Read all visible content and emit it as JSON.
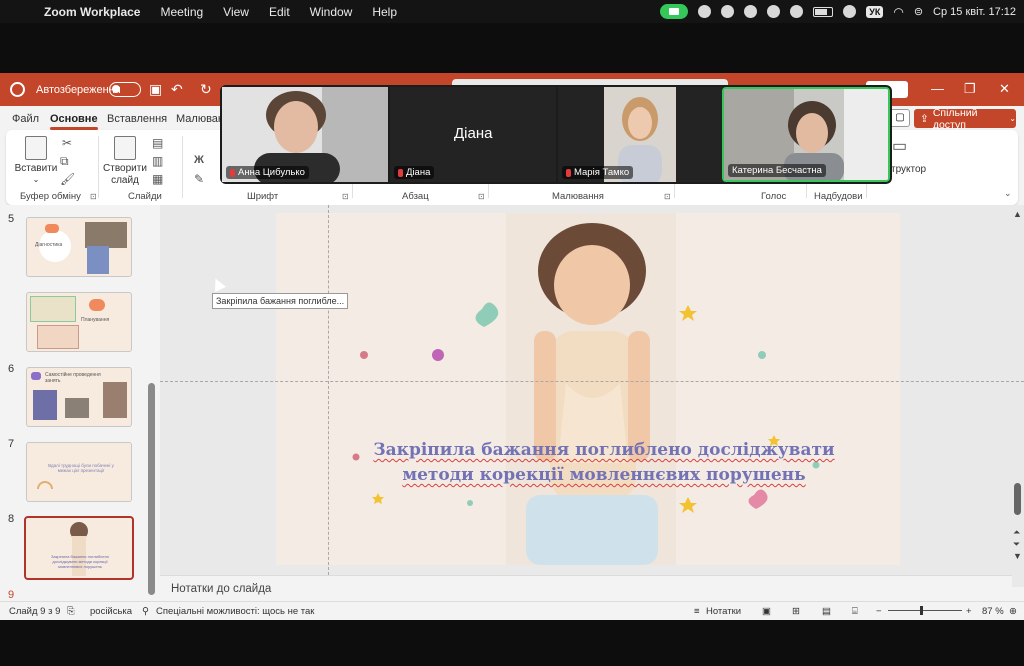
{
  "menubar": {
    "app_name": "Zoom Workplace",
    "items": [
      "Meeting",
      "View",
      "Edit",
      "Window",
      "Help"
    ],
    "keyboard": "УК",
    "clock": "Ср 15 квіт.  17:12"
  },
  "titlebar": {
    "autosave_label": "Автозбереження"
  },
  "ribbon": {
    "tabs": [
      "Файл",
      "Основне",
      "Вставлення",
      "Малюван"
    ],
    "active_tab": "Основне",
    "share_label": "Спільний доступ",
    "paste_label": "Вставити",
    "new_slide_label": "Створити слайд",
    "designer_label": "структор",
    "groups": [
      "Буфер обміну",
      "Слайди",
      "Шрифт",
      "Абзац",
      "Малювання",
      "Голос",
      "Надбудови"
    ],
    "font_bold": "Ж"
  },
  "zoom": {
    "participants": [
      {
        "name": "Анна Цибулько",
        "muted": true
      },
      {
        "name": "Діана",
        "muted": true
      },
      {
        "name": "Марія Тамко",
        "muted": true
      },
      {
        "name": "Катерина Бесчастна",
        "muted": false
      }
    ],
    "big_name": "Діана"
  },
  "slides": {
    "numbers": [
      "5",
      "6",
      "7",
      "8",
      "9"
    ],
    "selected": "9",
    "thumb_texts": [
      "Діагностика",
      "Планування",
      "Самостійне проведення занять",
      "Вдалі труднощі були побачені у межах цієї презентації",
      "Закріпила бажання поглиблено досліджувати методи корекції мовленнєвих порушень"
    ]
  },
  "editor": {
    "title_line1": "Закріпила бажання поглиблено досліджувати",
    "title_line2": "методи корекції мовленнєвих порушень",
    "tooltip": "Закріпила бажання поглибле..."
  },
  "notes": {
    "placeholder": "Нотатки до слайда"
  },
  "status": {
    "slide_counter": "Слайд 9 з 9",
    "language": "російська",
    "accessibility": "Спеціальні можливості: щось не так",
    "notes_label": "Нотатки",
    "zoom_percent": "87 %",
    "zoom_value": 0.45
  },
  "colors": {
    "accent": "#c4462a",
    "title_text": "#7272b5",
    "zoom_green": "#35c759"
  }
}
